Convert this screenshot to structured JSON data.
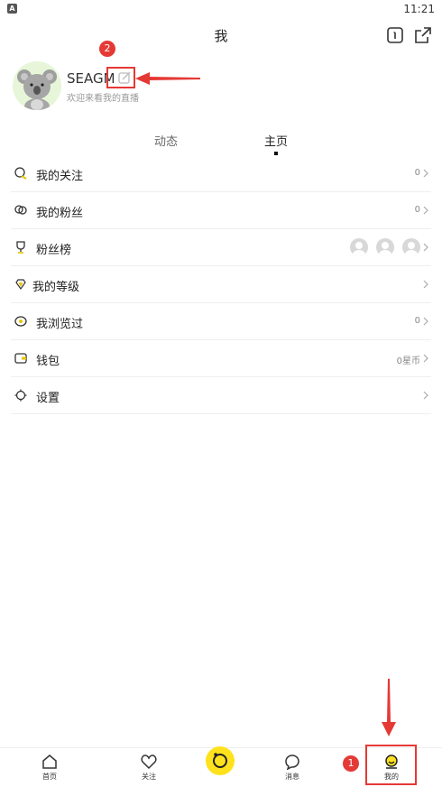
{
  "status_bar": {
    "time": "11:21",
    "app_icon_letter": "A"
  },
  "header": {
    "title": "我"
  },
  "profile": {
    "username": "SEAGM",
    "subtitle": "欢迎来看我的直播"
  },
  "tabs": [
    {
      "label": "动态",
      "active": false
    },
    {
      "label": "主页",
      "active": true
    }
  ],
  "menu": [
    {
      "label": "我的关注",
      "value": "0",
      "icon": "follow-icon"
    },
    {
      "label": "我的粉丝",
      "value": "0",
      "icon": "fans-icon"
    },
    {
      "label": "粉丝榜",
      "value": "",
      "icon": "trophy-icon"
    },
    {
      "label": "我的等级",
      "value": "",
      "icon": "diamond-icon"
    },
    {
      "label": "我浏览过",
      "value": "0",
      "icon": "eye-icon"
    },
    {
      "label": "钱包",
      "value": "0星币",
      "icon": "wallet-icon"
    },
    {
      "label": "设置",
      "value": "",
      "icon": "settings-icon"
    }
  ],
  "bottom_nav": [
    {
      "label": "首页",
      "icon": "home-icon"
    },
    {
      "label": "关注",
      "icon": "heart-icon"
    },
    {
      "label": "消息",
      "icon": "message-icon"
    },
    {
      "label": "我的",
      "icon": "profile-icon"
    }
  ],
  "annotations": {
    "badge_1": "1",
    "badge_2": "2"
  },
  "colors": {
    "accent_yellow": "#ffe21d",
    "annotation_red": "#e53935",
    "avatar_bg": "#e7f6d8"
  }
}
